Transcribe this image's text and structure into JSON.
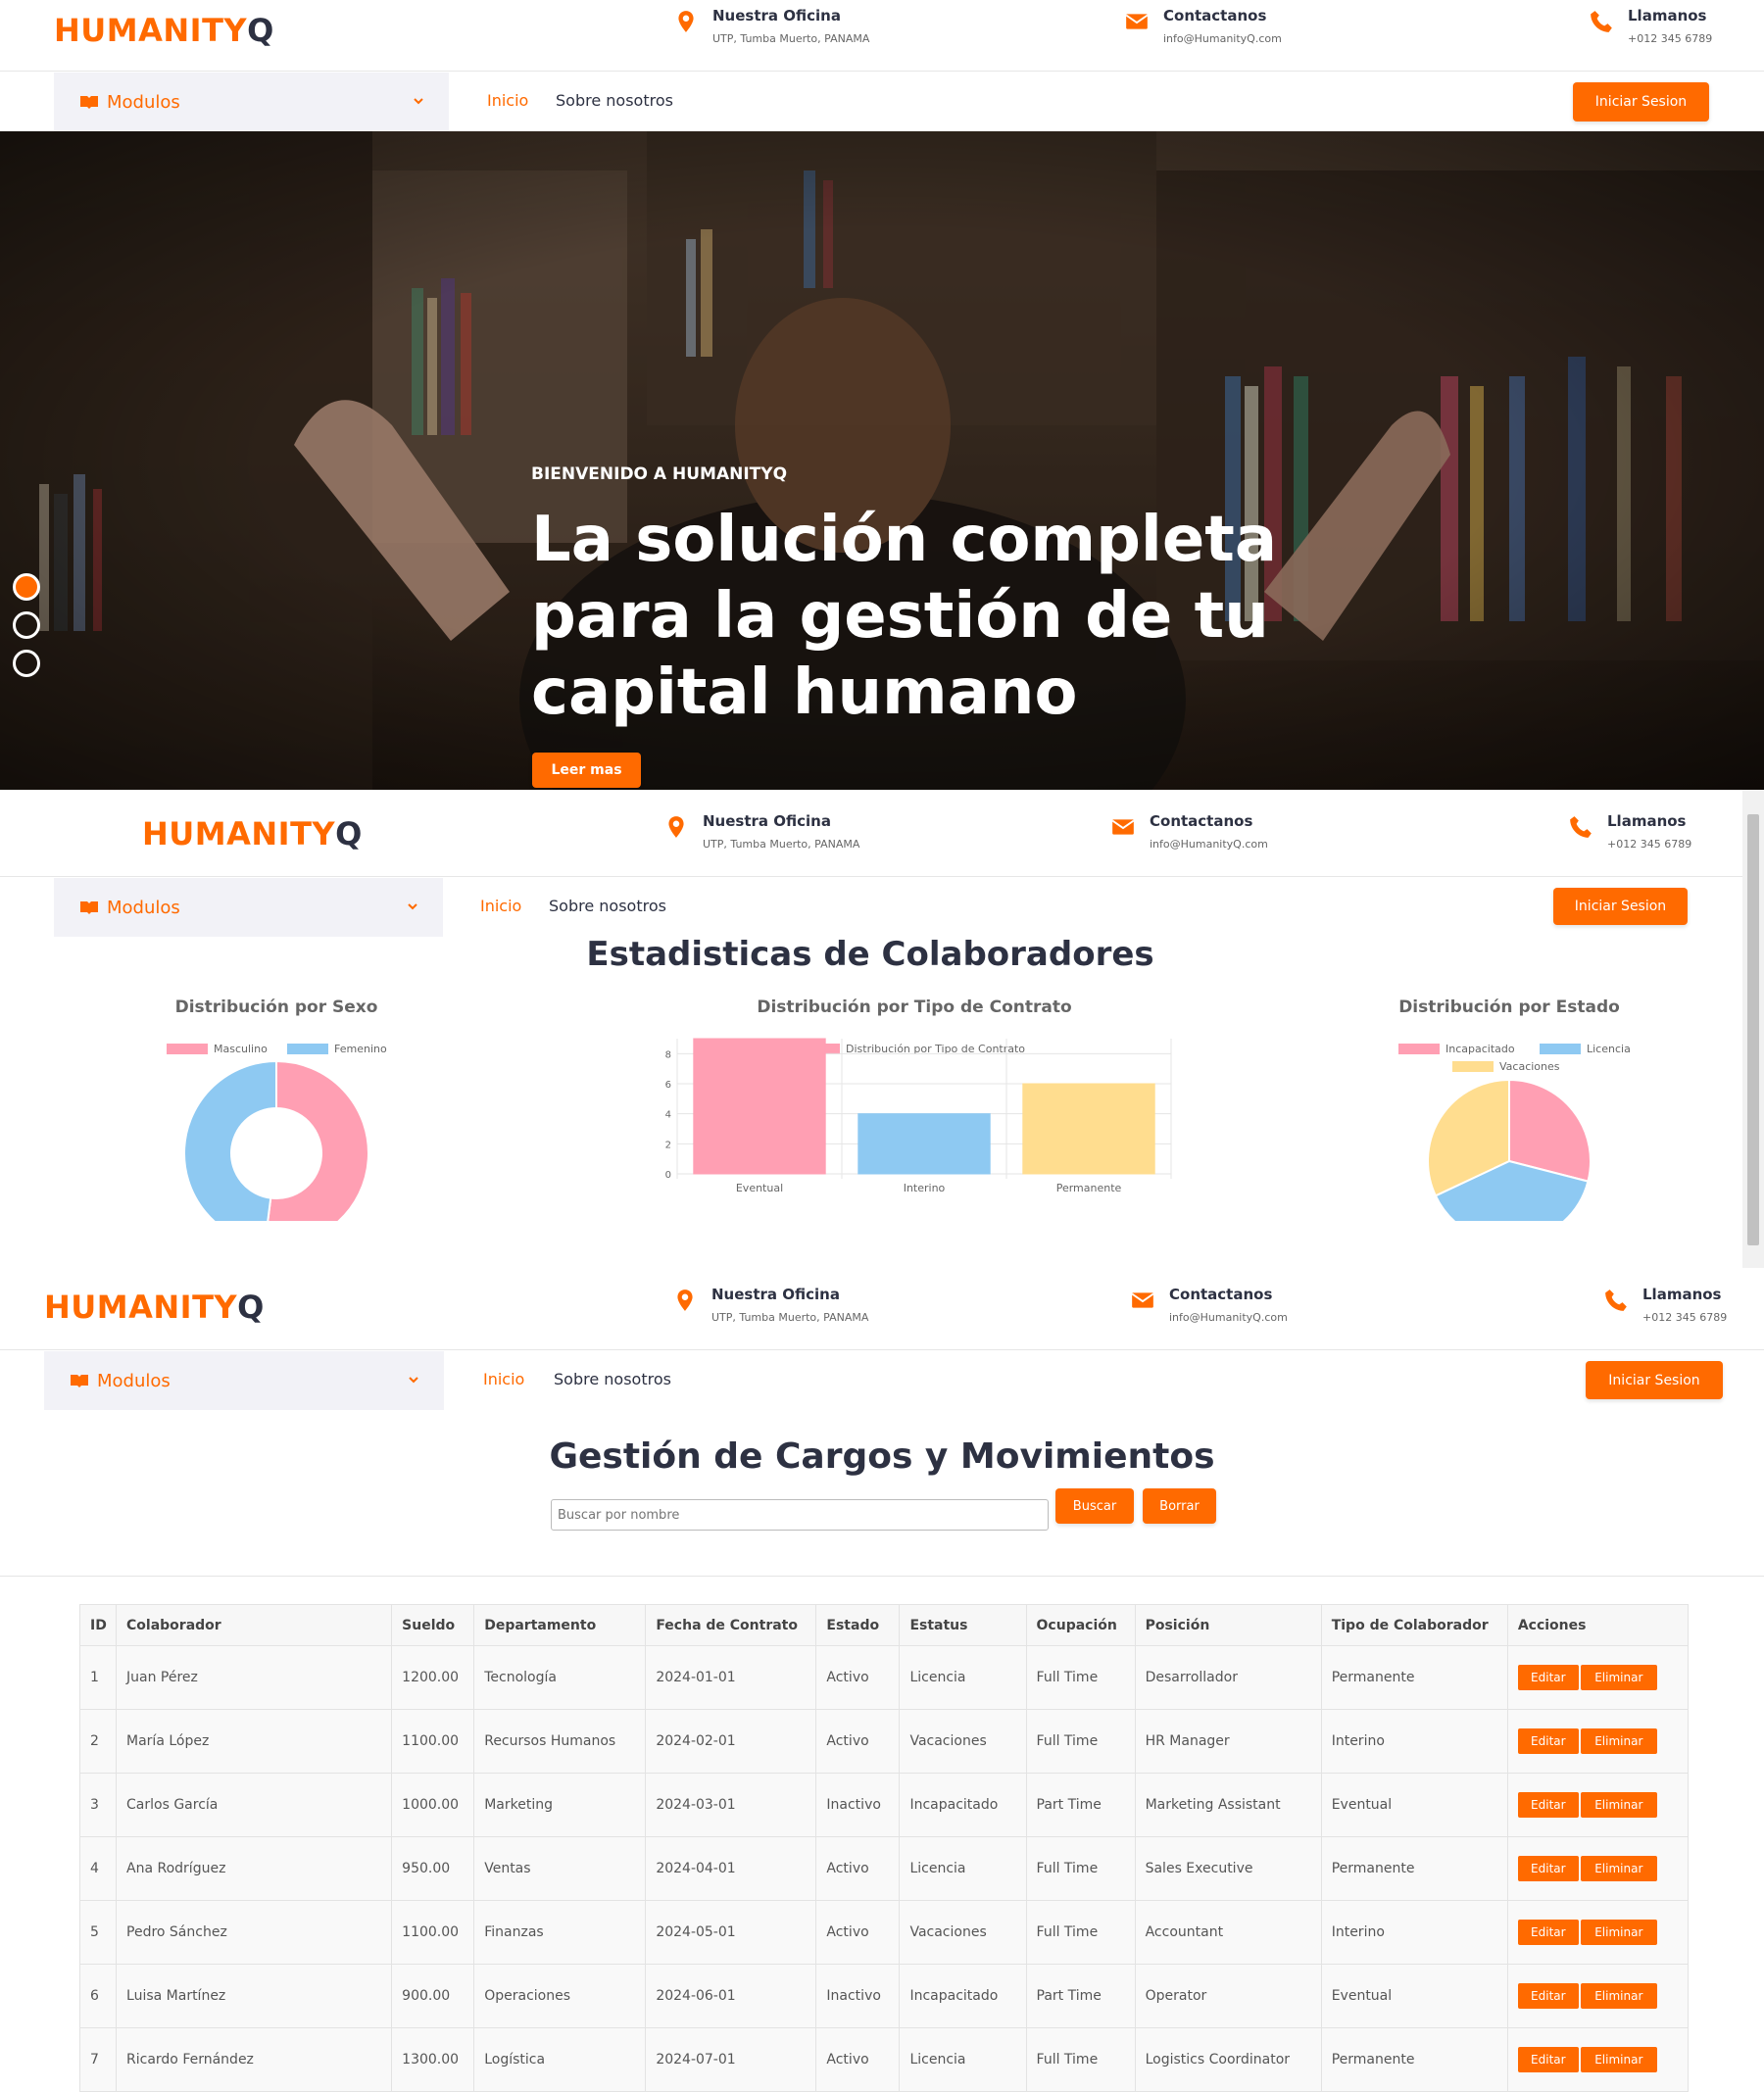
{
  "brand": {
    "logo_main": "HUMANITY",
    "logo_q": "Q",
    "accent": "#ff6a00",
    "dark": "#2d3142"
  },
  "contact": {
    "office_title": "Nuestra Oficina",
    "office_addr": "UTP, Tumba Muerto, PANAMA",
    "email_title": "Contactanos",
    "email_addr": "info@HumanityQ.com",
    "phone_title": "Llamanos",
    "phone_num": "+012 345 6789"
  },
  "nav": {
    "modulos": "Modulos",
    "inicio": "Inicio",
    "sobre": "Sobre nosotros",
    "login": "Iniciar Sesion"
  },
  "hero": {
    "eyebrow": "BIENVENIDO A HUMANITYQ",
    "headline": "La solución completa para la gestión de tu capital humano",
    "cta": "Leer mas",
    "slides": 3,
    "active_slide": 1
  },
  "stats": {
    "title": "Estadisticas de Colaboradores"
  },
  "chart_data": [
    {
      "type": "pie",
      "title": "Distribución por Sexo",
      "variant": "doughnut",
      "labels": [
        "Masculino",
        "Femenino"
      ],
      "values": [
        52,
        48
      ],
      "colors": [
        "#ff9fb3",
        "#8ec9f2"
      ]
    },
    {
      "type": "bar",
      "title": "Distribución por Tipo de Contrato",
      "series": [
        {
          "name": "Distribución por Tipo de Contrato",
          "values": [
            9,
            4,
            6
          ]
        }
      ],
      "categories": [
        "Eventual",
        "Interino",
        "Permanente"
      ],
      "yticks": [
        "0",
        "2",
        "4",
        "6",
        "8"
      ],
      "ylim": [
        0,
        9
      ],
      "colors": [
        "#ff9fb3",
        "#8ec9f2",
        "#ffdd8f"
      ]
    },
    {
      "type": "pie",
      "title": "Distribución por Estado",
      "labels": [
        "Incapacitado",
        "Licencia",
        "Vacaciones"
      ],
      "values": [
        29,
        39,
        32
      ],
      "colors": [
        "#ff9fb3",
        "#8ec9f2",
        "#ffdd8f"
      ]
    }
  ],
  "gestion": {
    "title": "Gestión de Cargos y Movimientos",
    "search_placeholder": "Buscar por nombre",
    "buscar": "Buscar",
    "borrar": "Borrar",
    "columns": [
      "ID",
      "Colaborador",
      "Sueldo",
      "Departamento",
      "Fecha de Contrato",
      "Estado",
      "Estatus",
      "Ocupación",
      "Posición",
      "Tipo de Colaborador",
      "Acciones"
    ],
    "edit": "Editar",
    "delete": "Eliminar",
    "rows": [
      [
        "1",
        "Juan Pérez",
        "1200.00",
        "Tecnología",
        "2024-01-01",
        "Activo",
        "Licencia",
        "Full Time",
        "Desarrollador",
        "Permanente"
      ],
      [
        "2",
        "María López",
        "1100.00",
        "Recursos Humanos",
        "2024-02-01",
        "Activo",
        "Vacaciones",
        "Full Time",
        "HR Manager",
        "Interino"
      ],
      [
        "3",
        "Carlos García",
        "1000.00",
        "Marketing",
        "2024-03-01",
        "Inactivo",
        "Incapacitado",
        "Part Time",
        "Marketing Assistant",
        "Eventual"
      ],
      [
        "4",
        "Ana Rodríguez",
        "950.00",
        "Ventas",
        "2024-04-01",
        "Activo",
        "Licencia",
        "Full Time",
        "Sales Executive",
        "Permanente"
      ],
      [
        "5",
        "Pedro Sánchez",
        "1100.00",
        "Finanzas",
        "2024-05-01",
        "Activo",
        "Vacaciones",
        "Full Time",
        "Accountant",
        "Interino"
      ],
      [
        "6",
        "Luisa Martínez",
        "900.00",
        "Operaciones",
        "2024-06-01",
        "Inactivo",
        "Incapacitado",
        "Part Time",
        "Operator",
        "Eventual"
      ],
      [
        "7",
        "Ricardo Fernández",
        "1300.00",
        "Logística",
        "2024-07-01",
        "Activo",
        "Licencia",
        "Full Time",
        "Logistics Coordinator",
        "Permanente"
      ]
    ]
  }
}
